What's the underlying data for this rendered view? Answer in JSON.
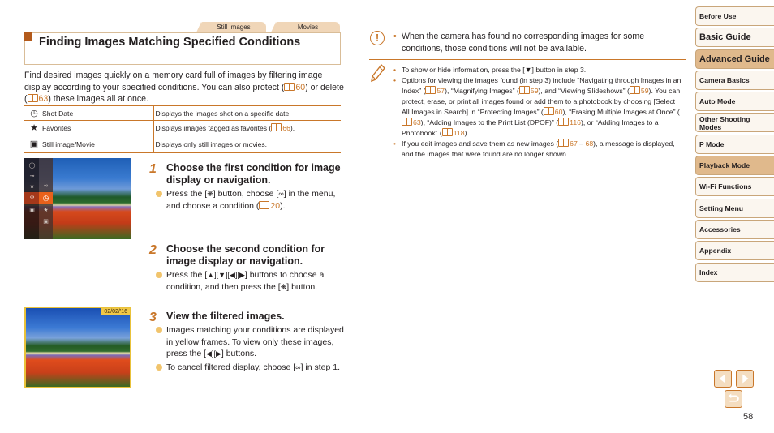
{
  "tabs": [
    {
      "label": "Still Images"
    },
    {
      "label": "Movies"
    }
  ],
  "heading": {
    "title": "Finding Images Matching Specified Conditions"
  },
  "intro": {
    "part1": "Find desired images quickly on a memory card full of images by filtering image display according to your specified conditions. You can also protect (",
    "ref1": "60",
    "part2": ") or delete (",
    "ref2": "63",
    "part3": ") these images all at once."
  },
  "conditions": [
    {
      "icon": "clock-icon",
      "name": "Shot Date",
      "description": "Displays the images shot on a specific date.",
      "ref": ""
    },
    {
      "icon": "star-icon",
      "name": "Favorites",
      "description": "Displays images tagged as favorites (",
      "ref": "66",
      "suffix": ")."
    },
    {
      "icon": "still-movie-icon",
      "name": "Still image/Movie",
      "description": "Displays only still images or movies.",
      "ref": ""
    }
  ],
  "screen_image": {
    "date_overlay": "02/02/'16"
  },
  "steps": [
    {
      "number": "1",
      "title": "Choose the first condition for image display or navigation.",
      "bullets": [
        {
          "a": "Press the [",
          "b": "] button, choose [",
          "c": "] in the menu, and choose a condition (",
          "ref": "20",
          "d": ")."
        }
      ]
    },
    {
      "number": "2",
      "title": "Choose the second condition for image display or navigation.",
      "bullets": [
        {
          "a": "Press the [",
          "b": "] buttons to choose a condition, and then press the [",
          "c": "] button."
        }
      ]
    },
    {
      "number": "3",
      "title": "View the filtered images.",
      "bullets": [
        {
          "a": "Images matching your conditions are displayed in yellow frames. To view only these images, press the [",
          "b": "] buttons."
        },
        {
          "a": "To cancel filtered display, choose [",
          "b": "] in step 1."
        }
      ]
    }
  ],
  "caution": {
    "text": "When the camera has found no corresponding images for some conditions, those conditions will not be available."
  },
  "notes": {
    "n1": {
      "a": "To show or hide information, press the [",
      "b": "] button in step 3."
    },
    "n2": {
      "a": "Options for viewing the images found (in step 3) include “Navigating through Images in an Index” (",
      "r1": "57",
      "b": "), “Magnifying Images” (",
      "r2": "59",
      "c": "), and “Viewing Slideshows” (",
      "r3": "59",
      "d": "). You can protect, erase, or print all images found or add them to a photobook by choosing [Select All Images in Search] in “Protecting Images” (",
      "r4": "60",
      "e": "), “Erasing Multiple Images at Once” (",
      "r5": "63",
      "f": "), “Adding Images to the Print List (DPOF)” (",
      "r6": "116",
      "g": "), or “Adding Images to a Photobook” (",
      "r7": "118",
      "h": ")."
    },
    "n3": {
      "a": "If you edit images and save them as new images (",
      "r1": "67",
      "sep": " – ",
      "r2": "68",
      "b": "), a message is displayed, and the images that were found are no longer shown."
    }
  },
  "sidebar": {
    "items": [
      {
        "label": "Before Use"
      },
      {
        "label": "Basic Guide"
      },
      {
        "label": "Advanced Guide"
      },
      {
        "label": "Camera Basics"
      },
      {
        "label": "Auto Mode"
      },
      {
        "label": "Other Shooting Modes"
      },
      {
        "label": "P Mode"
      },
      {
        "label": "Playback Mode"
      },
      {
        "label": "Wi-Fi Functions"
      },
      {
        "label": "Setting Menu"
      },
      {
        "label": "Accessories"
      },
      {
        "label": "Appendix"
      },
      {
        "label": "Index"
      }
    ]
  },
  "page": {
    "number": "58"
  },
  "colors": {
    "accent": "#c9772a",
    "active_nav": "#e0b98c",
    "heading_square": "#b35a1b"
  }
}
